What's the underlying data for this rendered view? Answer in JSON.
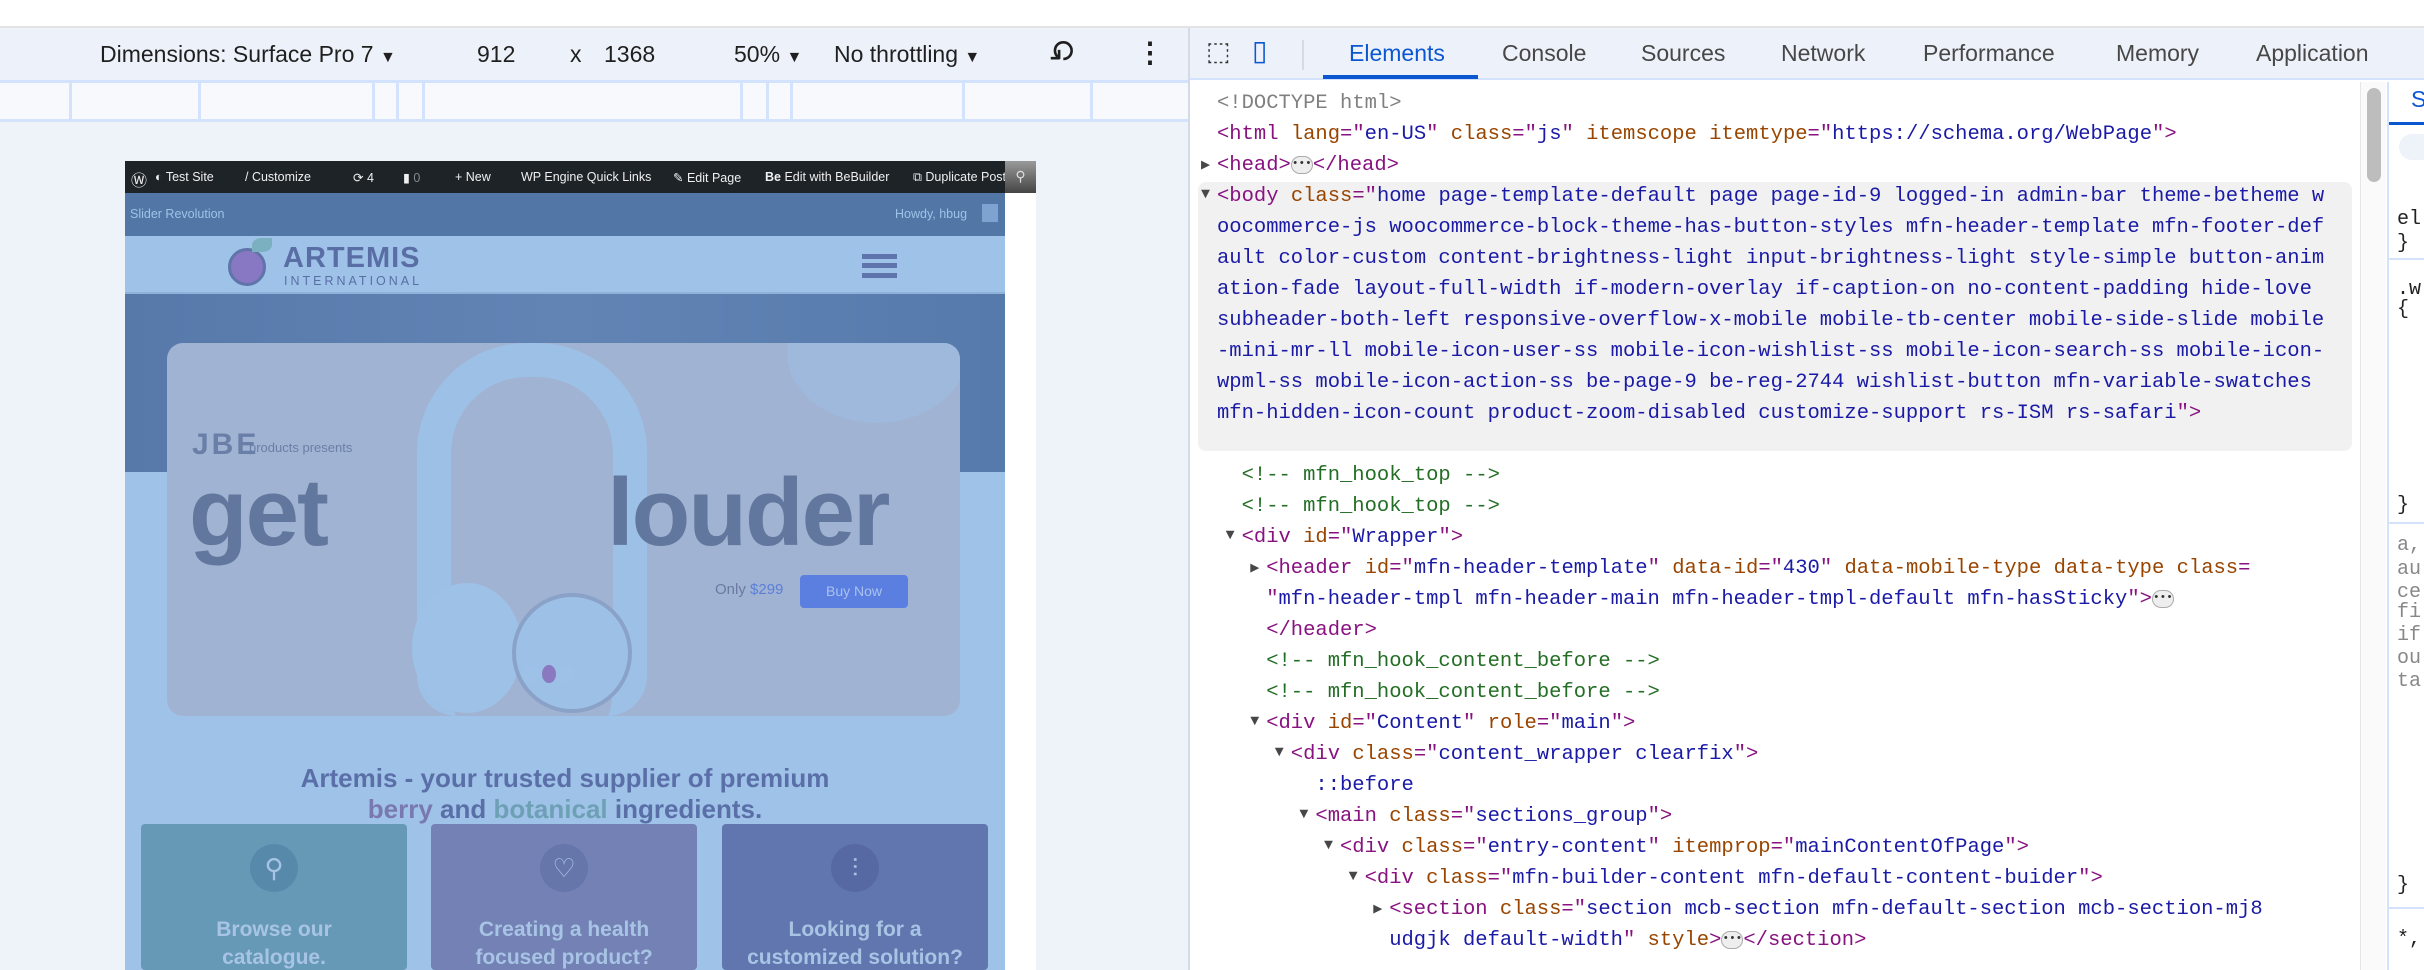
{
  "device_toolbar": {
    "dimensions": "Dimensions: Surface Pro 7",
    "width": "912",
    "times": "x",
    "height": "1368",
    "zoom": "50%",
    "throttling": "No throttling",
    "rotate_icon": "rotate-icon",
    "more_icon": "kebab-icon"
  },
  "site": {
    "admin_bar": [
      "Test Site",
      "Customize",
      "4",
      "0",
      "New",
      "WP Engine Quick Links",
      "Edit Page",
      "Edit with BeBuilder",
      "Duplicate Post"
    ],
    "be_logo": "Be",
    "sub_left": "Slider Revolution",
    "howdy": "Howdy, hbug",
    "logo_main": "ARTEMIS",
    "logo_sub": "INTERNATIONAL",
    "hero": {
      "brand": "JBE",
      "presents": "products presents",
      "headline_left": "get",
      "headline_right": "louder",
      "only": "Only",
      "price": "$299",
      "buy": "Buy Now"
    },
    "tagline1": "Artemis - your trusted supplier of premium",
    "tag_berry": "berry",
    "tag_and": " and ",
    "tag_botanical": "botanical",
    "tag_rest": " ingredients.",
    "boxes": [
      {
        "icon": "search-icon",
        "line1": "Browse our",
        "line2": "catalogue."
      },
      {
        "icon": "heart-icon",
        "line1": "Creating a health",
        "line2": "focused product?"
      },
      {
        "icon": "sliders-icon",
        "line1": "Looking for a",
        "line2": "customized solution?"
      }
    ]
  },
  "devtools": {
    "tabs": [
      "Elements",
      "Console",
      "Sources",
      "Network",
      "Performance",
      "Memory",
      "Application"
    ],
    "active_tab": "Elements",
    "styles_tab": "S",
    "colors": {
      "accent": "#0b57d0",
      "tag": "#881280",
      "attr": "#994500",
      "value": "#1a1aa6",
      "comment": "#236e25"
    },
    "body_classes": "home page-template-default page page-id-9 logged-in admin-bar theme-betheme woocommerce-js woocommerce-block-theme-has-button-styles mfn-header-template mfn-footer-default color-custom content-brightness-light input-brightness-light style-simple button-animation-fade layout-full-width if-modern-overlay if-caption-on no-content-padding hide-love subheader-both-left responsive-overflow-x-mobile mobile-tb-center mobile-side-slide mobile-mini-mr-ll mobile-icon-user-ss mobile-icon-wishlist-ss mobile-icon-search-ss mobile-icon-wpml-ss mobile-icon-action-ss be-page-9 be-reg-2744 wishlist-button mfn-variable-swatches mfn-hidden-icon-count product-zoom-disabled customize-support rs-ISM rs-safari",
    "styles_fragments": [
      "el",
      "}",
      ".w",
      "{",
      "}",
      "a,",
      "au",
      "ce",
      "fi",
      "if",
      "ou",
      "ta",
      "}",
      "*,"
    ]
  }
}
